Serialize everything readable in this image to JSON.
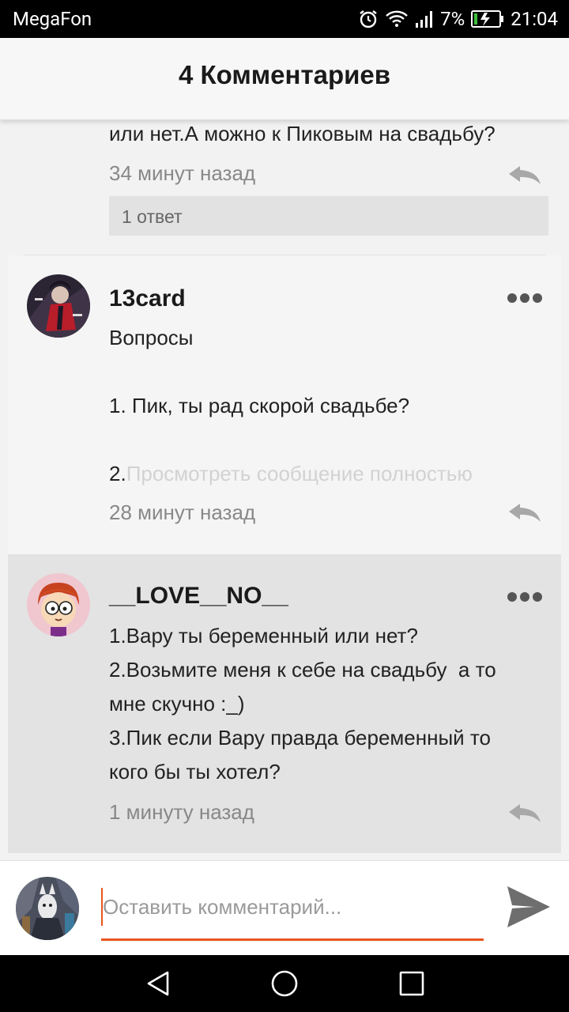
{
  "status_bar": {
    "carrier": "MegaFon",
    "battery_percent": "7%",
    "time": "21:04",
    "icons": [
      "alarm-icon",
      "wifi-icon",
      "signal-icon",
      "battery-charging-icon"
    ]
  },
  "header": {
    "title": "4 Комментариев"
  },
  "comments": [
    {
      "text": "или нет.А можно к Пиковым на свадьбу?",
      "time": "34 минут назад",
      "replies_label": "1 ответ"
    },
    {
      "author": "13card",
      "lines": [
        "Вопросы",
        "",
        "1. Пик, ты рад скорой свадьбе?",
        ""
      ],
      "last_prefix": "2.",
      "expand_link": "Просмотреть сообщение полностью",
      "time": "28 минут назад"
    },
    {
      "author": "__LOVE__NO__",
      "lines": [
        "1.Вару ты беременный или нет?",
        "2.Возьмите меня к себе на свадьбу  а то",
        "мне скучно :_)",
        "3.Пик если Вару правда беременный то",
        "кого бы ты хотел?"
      ],
      "time": "1 минуту назад"
    }
  ],
  "input": {
    "placeholder": "Оставить комментарий..."
  },
  "colors": {
    "accent": "#e8551e",
    "header_bg": "#f7f7f7",
    "highlight_bg": "#e3e3e3"
  },
  "nav_bar": {
    "icons": [
      "back-icon",
      "home-icon",
      "recents-icon"
    ]
  }
}
